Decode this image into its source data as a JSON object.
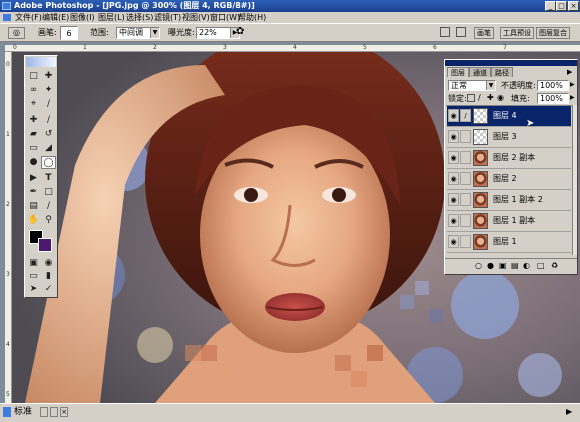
{
  "window": {
    "title": "Adobe Photoshop - [JPG.jpg @ 300% (图层 4, RGB/8#)]",
    "controls": [
      "_",
      "□",
      "×"
    ]
  },
  "menu": [
    "文件(F)",
    "编辑(E)",
    "图像(I)",
    "图层(L)",
    "选择(S)",
    "滤镜(T)",
    "视图(V)",
    "窗口(W)",
    "帮助(H)"
  ],
  "options": {
    "brush_label": "画笔:",
    "brush_size": "6",
    "range_label": "范围:",
    "range_value": "中间调",
    "exposure_label": "曝光度:",
    "exposure_value": "22%",
    "palette_well": [
      "画笔",
      "工具预设",
      "图层复合"
    ]
  },
  "ruler": {
    "top_marks": [
      "0",
      "1",
      "2",
      "3",
      "4",
      "5",
      "6",
      "7"
    ],
    "left_marks": [
      "0",
      "1",
      "2",
      "3",
      "4",
      "5"
    ]
  },
  "layers_panel": {
    "tabs": [
      "图层",
      "通道",
      "路径"
    ],
    "blend_mode": "正常",
    "opacity_label": "不透明度:",
    "opacity_value": "100%",
    "lock_label": "锁定:",
    "fill_label": "填充:",
    "fill_value": "100%",
    "layers": [
      {
        "name": "图层 4",
        "selected": true,
        "thumb": "transparent"
      },
      {
        "name": "图层 3",
        "selected": false,
        "thumb": "transparent"
      },
      {
        "name": "图层 2 副本",
        "selected": false,
        "thumb": "photo"
      },
      {
        "name": "图层 2",
        "selected": false,
        "thumb": "photo"
      },
      {
        "name": "图层 1 副本 2",
        "selected": false,
        "thumb": "photo"
      },
      {
        "name": "图层 1 副本",
        "selected": false,
        "thumb": "photo"
      },
      {
        "name": "图层 1",
        "selected": false,
        "thumb": "photo"
      }
    ]
  },
  "status": {
    "zoom": "标准"
  },
  "colors": {
    "foreground": "#000000",
    "background": "#4b1a6e",
    "selection": "#0a246a"
  }
}
